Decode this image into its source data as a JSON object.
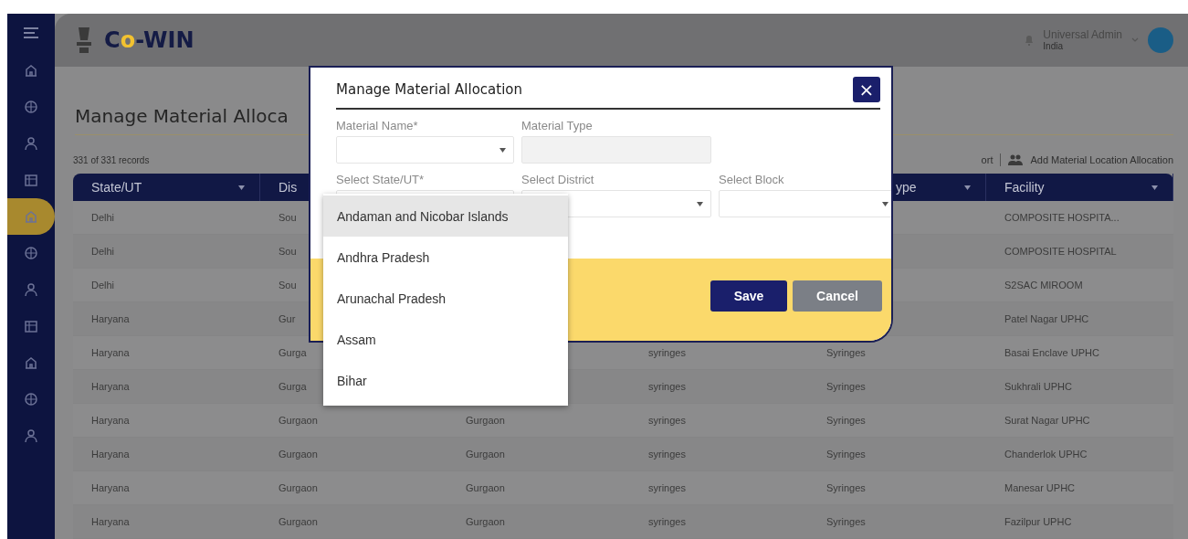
{
  "sidebar": {
    "items": [
      {
        "selected": false
      },
      {
        "selected": false
      },
      {
        "selected": false
      },
      {
        "selected": false
      },
      {
        "selected": true
      },
      {
        "selected": false
      },
      {
        "selected": false
      },
      {
        "selected": false
      },
      {
        "selected": false
      },
      {
        "selected": false
      },
      {
        "selected": false
      }
    ]
  },
  "header": {
    "logo": [
      {
        "text": "C",
        "accent": false
      },
      {
        "text": "o",
        "accent": true
      },
      {
        "text": "-WIN",
        "accent": false
      }
    ],
    "user_name": "Universal Admin",
    "user_location": "India"
  },
  "page": {
    "title": "Manage Material Alloca",
    "records": "331 of 331 records",
    "export_link": "ort",
    "add_link": "Add Material Location Allocation"
  },
  "table": {
    "columns": [
      {
        "label": "State/UT",
        "filter": true
      },
      {
        "label": "Dis"
      },
      {},
      {},
      {
        "label": "ype",
        "filter": true
      },
      {
        "label": "Facility",
        "filter": true
      }
    ],
    "rows": [
      {
        "state_ut": "Delhi",
        "column_2": "Sou",
        "facility": "COMPOSITE HOSPITA..."
      },
      {
        "state_ut": "Delhi",
        "column_2": "Sou",
        "facility": "COMPOSITE HOSPITAL"
      },
      {
        "state_ut": "Delhi",
        "column_2": "Sou",
        "facility": "S2SAC MIROOM"
      },
      {
        "state_ut": "Haryana",
        "column_2": "Gur",
        "facility": "Patel Nagar UPHC"
      },
      {
        "state_ut": "Haryana",
        "column_2": "Gurga",
        "column_4": "syringes",
        "column_5": "Syringes",
        "facility": "Basai Enclave UPHC"
      },
      {
        "state_ut": "Haryana",
        "column_2": "Gurga",
        "column_4": "syringes",
        "column_5": "Syringes",
        "facility": "Sukhrali UPHC"
      },
      {
        "state_ut": "Haryana",
        "column_2": "Gurgaon",
        "column_3": "Gurgaon",
        "column_4": "syringes",
        "column_5": "Syringes",
        "facility": "Surat Nagar UPHC"
      },
      {
        "state_ut": "Haryana",
        "column_2": "Gurgaon",
        "column_3": "Gurgaon",
        "column_4": "syringes",
        "column_5": "Syringes",
        "facility": "Chanderlok UPHC"
      },
      {
        "state_ut": "Haryana",
        "column_2": "Gurgaon",
        "column_3": "Gurgaon",
        "column_4": "syringes",
        "column_5": "Syringes",
        "facility": "Manesar UPHC"
      },
      {
        "state_ut": "Haryana",
        "column_2": "Gurgaon",
        "column_3": "Gurgaon",
        "column_4": "syringes",
        "column_5": "Syringes",
        "facility": "Fazilpur UPHC"
      }
    ]
  },
  "modal": {
    "title": "Manage Material Allocation",
    "close": "×",
    "fields": [
      {
        "label": "Material Name*",
        "kind": "select",
        "disabled": false
      },
      {
        "label": "Material Type",
        "kind": "text",
        "disabled": true
      }
    ],
    "location_fields": [
      {
        "label": "Select State/UT*",
        "kind": "select",
        "disabled": false
      },
      {
        "label": "Select District",
        "kind": "select",
        "disabled": false
      },
      {
        "label": "Select Block",
        "kind": "select",
        "disabled": false
      }
    ],
    "dropdown": [
      {
        "label": "Andaman and Nicobar Islands",
        "selected": true
      },
      {
        "label": "Andhra Pradesh",
        "selected": false
      },
      {
        "label": "Arunachal Pradesh",
        "selected": false
      },
      {
        "label": "Assam",
        "selected": false
      },
      {
        "label": "Bihar",
        "selected": false
      }
    ],
    "buttons": [
      {
        "label": "Save",
        "kind": "primary"
      },
      {
        "label": "Cancel",
        "kind": "secondary"
      }
    ]
  }
}
